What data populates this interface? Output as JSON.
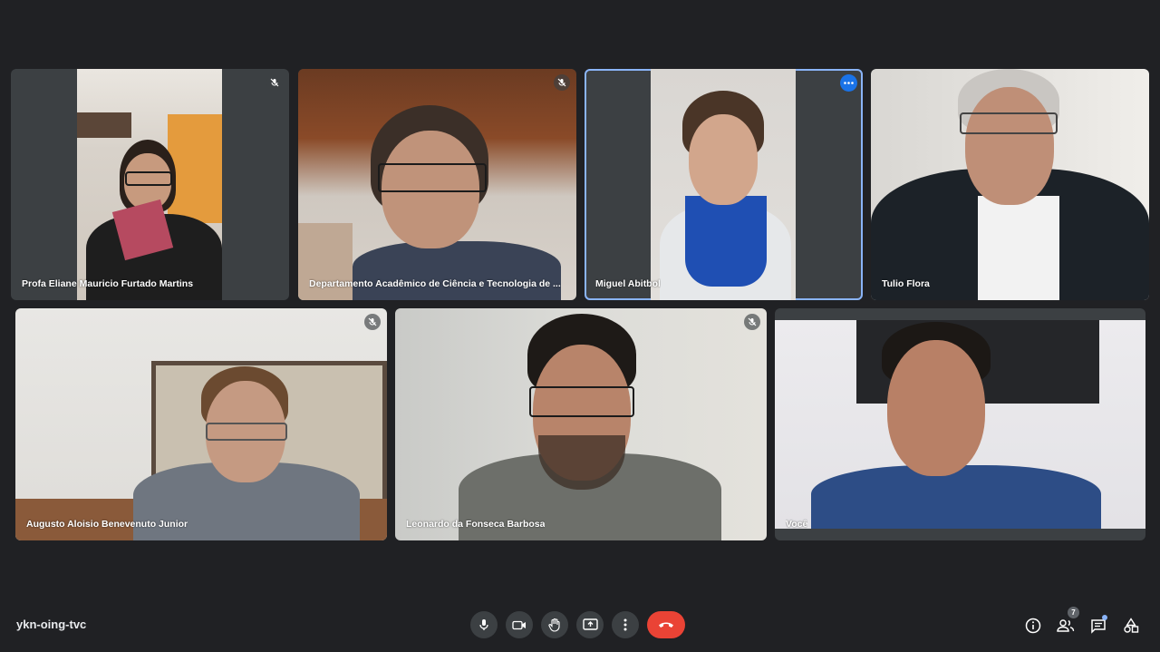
{
  "participants": [
    {
      "name": "Profa Eliane Mauricio Furtado Martins",
      "muted": true
    },
    {
      "name": "Departamento Acadêmico de Ciência e Tecnologia de ...",
      "muted": true
    },
    {
      "name": "Miguel Abitbol",
      "muted": false,
      "active": true
    },
    {
      "name": "Tulio Flora",
      "muted": false
    },
    {
      "name": "Augusto Aloisio Benevenuto Junior",
      "muted": true
    },
    {
      "name": "Leonardo da Fonseca Barbosa",
      "muted": true
    },
    {
      "name": "Você",
      "muted": false
    }
  ],
  "meeting": {
    "code": "ykn-oing-tvc"
  },
  "people_count": "7",
  "colors": {
    "background": "#202124",
    "tile": "#3c4043",
    "accent": "#1a73e8",
    "end_call": "#ea4335",
    "active_outline": "#8ab4f8"
  },
  "icons": {
    "controls": [
      "microphone-icon",
      "camera-icon",
      "raise-hand-icon",
      "present-screen-icon",
      "more-options-icon",
      "end-call-icon"
    ],
    "right": [
      "info-icon",
      "people-icon",
      "chat-icon",
      "activities-icon"
    ]
  }
}
